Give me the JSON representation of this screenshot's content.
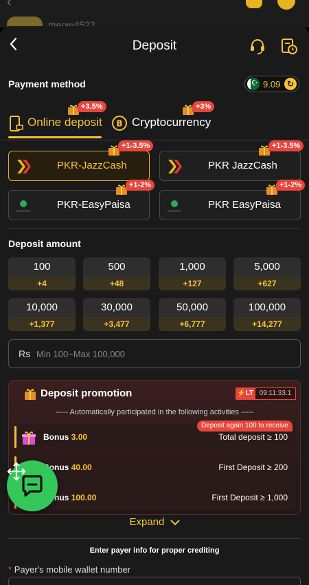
{
  "background": {
    "username": "meow4522"
  },
  "header": {
    "title": "Deposit"
  },
  "payment": {
    "label": "Payment method",
    "balance": "9.09"
  },
  "tabs": [
    {
      "label": "Online deposit",
      "badge": "+3.5%"
    },
    {
      "label": "Cryptocurrency",
      "badge": "+3%"
    }
  ],
  "methods": [
    {
      "label": "PKR-JazzCash",
      "badge": "+1-3.5%",
      "logo": "jazzcash"
    },
    {
      "label": "PKR JazzCash",
      "badge": "+1-3.5%",
      "logo": "jazzcash"
    },
    {
      "label": "PKR-EasyPaisa",
      "badge": "+1-2%",
      "logo": "easypaisa"
    },
    {
      "label": "PKR EasyPaisa",
      "badge": "+1-2%",
      "logo": "easypaisa"
    }
  ],
  "deposit_amount": {
    "label": "Deposit amount",
    "options": [
      {
        "amount": "100",
        "bonus": "+4"
      },
      {
        "amount": "500",
        "bonus": "+48"
      },
      {
        "amount": "1,000",
        "bonus": "+127"
      },
      {
        "amount": "5,000",
        "bonus": "+627"
      },
      {
        "amount": "10,000",
        "bonus": "+1,377"
      },
      {
        "amount": "30,000",
        "bonus": "+3,477"
      },
      {
        "amount": "50,000",
        "bonus": "+6,777"
      },
      {
        "amount": "100,000",
        "bonus": "+14,277"
      }
    ],
    "currency": "Rs",
    "placeholder": "Min 100~Max 100,000"
  },
  "promotion": {
    "title": "Deposit promotion",
    "lt_label": "LT",
    "timer": "09:11:33.1",
    "subtitle": "----- Automatically participated in the following activities -----",
    "again_tag": "Deposit again 100 to receive",
    "rows": [
      {
        "label": "Bonus",
        "amount": "3.00",
        "condition": "Total deposit ≥ 100"
      },
      {
        "label": "Bonus",
        "amount": "40.00",
        "condition": "First Deposit ≥ 200"
      },
      {
        "label": "Bonus",
        "amount": "100.00",
        "condition": "First Deposit ≥ 1,000"
      }
    ],
    "expand": "Expand"
  },
  "payer": {
    "note": "Enter payer info for proper crediting",
    "field_label": "Payer's mobile wallet number",
    "required_mark": "*"
  },
  "colors": {
    "accent": "#f5c23b",
    "badge": "#e8453c",
    "chat_fab": "#34c759"
  }
}
